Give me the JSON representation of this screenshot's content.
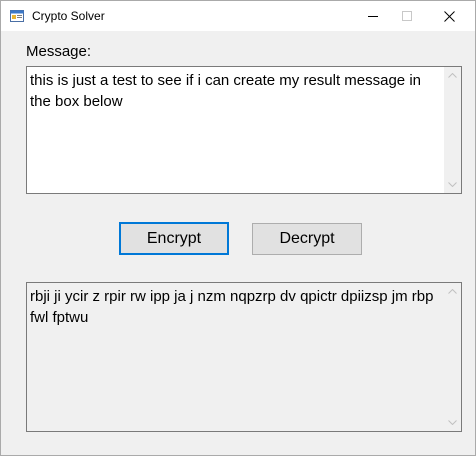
{
  "window": {
    "title": "Crypto Solver",
    "icons": {
      "app": "app-icon",
      "minimize": "minimize-icon",
      "maximize": "maximize-icon",
      "close": "close-icon"
    }
  },
  "form": {
    "message_label": "Message:",
    "message_value": "this is just a test to see if i can create my result message in the box below",
    "result_value": "rbji ji ycir z rpir rw ipp ja j nzm nqpzrp dv qpictr dpiizsp jm rbp fwl fptwu",
    "encrypt_label": "Encrypt",
    "decrypt_label": "Decrypt"
  },
  "colors": {
    "focus_border": "#0078d7",
    "button_face": "#e1e1e1",
    "window_bg": "#f0f0f0"
  }
}
